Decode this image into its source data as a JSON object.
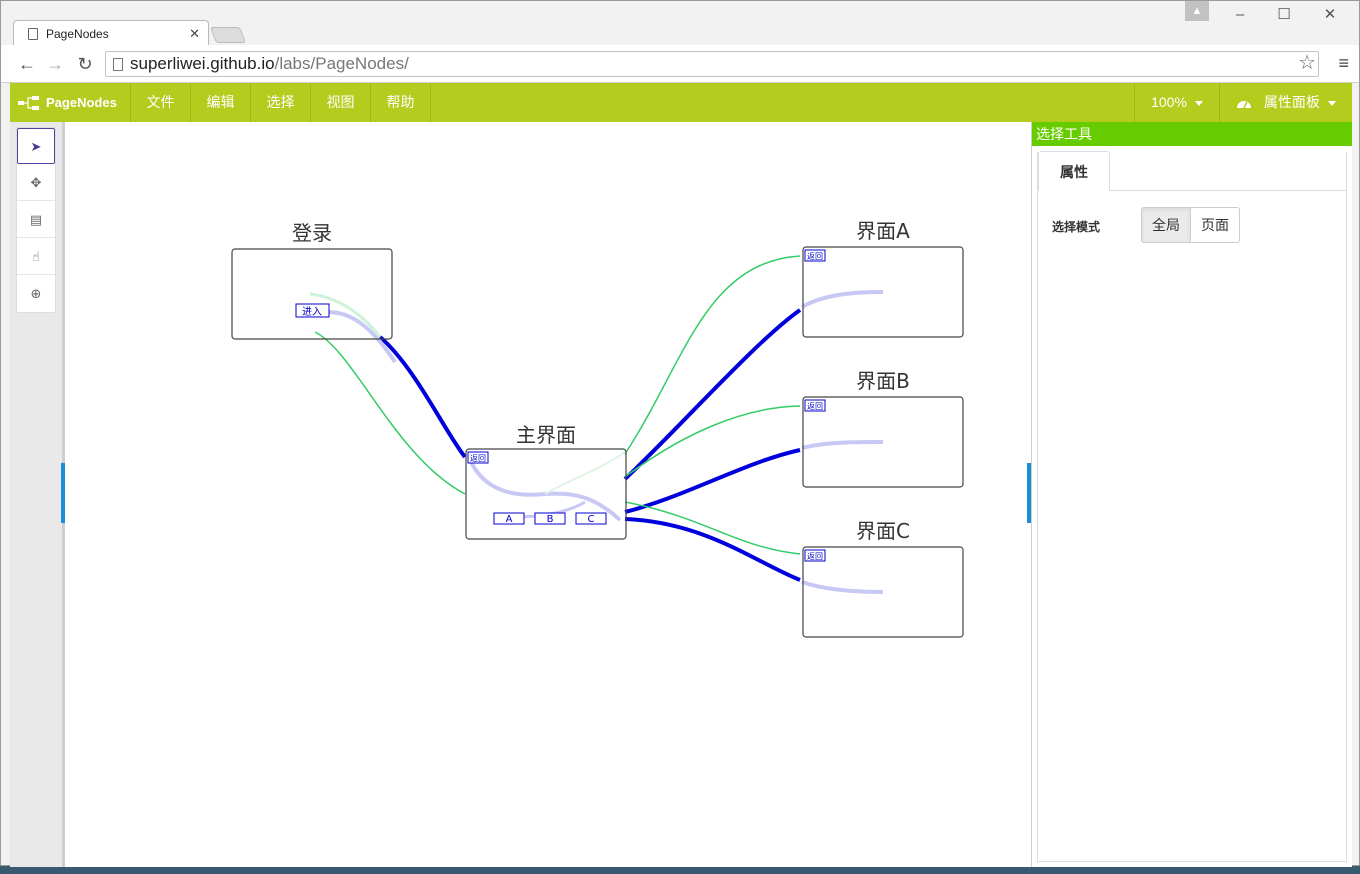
{
  "browser": {
    "tab_title": "PageNodes",
    "tab_close": "✕",
    "url_host": "superliwei.github.io",
    "url_path": "/labs/PageNodes/",
    "back": "←",
    "forward": "→",
    "reload": "↻",
    "star": "☆",
    "menu": "≡",
    "minimize": "–",
    "maximize": "☐",
    "close": "✕",
    "user_badge": "▲"
  },
  "app": {
    "brand": "PageNodes",
    "menus": [
      "文件",
      "编辑",
      "选择",
      "视图",
      "帮助"
    ],
    "zoom": "100%",
    "panel_toggle": "属性面板"
  },
  "tools": [
    "select-tool",
    "move-tool",
    "page-tool",
    "hand-tool",
    "zoom-tool"
  ],
  "tool_glyphs": [
    "➤",
    "✥",
    "▤",
    "☝",
    "⊕"
  ],
  "right_panel": {
    "header": "选择工具",
    "tab": "属性",
    "select_mode_label": "选择模式",
    "mode_options": [
      "全局",
      "页面"
    ],
    "mode_selected": "全局"
  },
  "nodes": {
    "login": {
      "title": "登录",
      "button": "进入"
    },
    "main": {
      "title": "主界面",
      "back": "返回",
      "buttons": [
        "A",
        "B",
        "C"
      ]
    },
    "pageA": {
      "title": "界面A",
      "back": "返回"
    },
    "pageB": {
      "title": "界面B",
      "back": "返回"
    },
    "pageC": {
      "title": "界面C",
      "back": "返回"
    }
  },
  "colors": {
    "appbar": "#b4cc1e",
    "panel_header": "#66cc00",
    "link_strong": "#0000dd",
    "link_green": "#33cc66",
    "link_faded": "#c8c8f5"
  }
}
